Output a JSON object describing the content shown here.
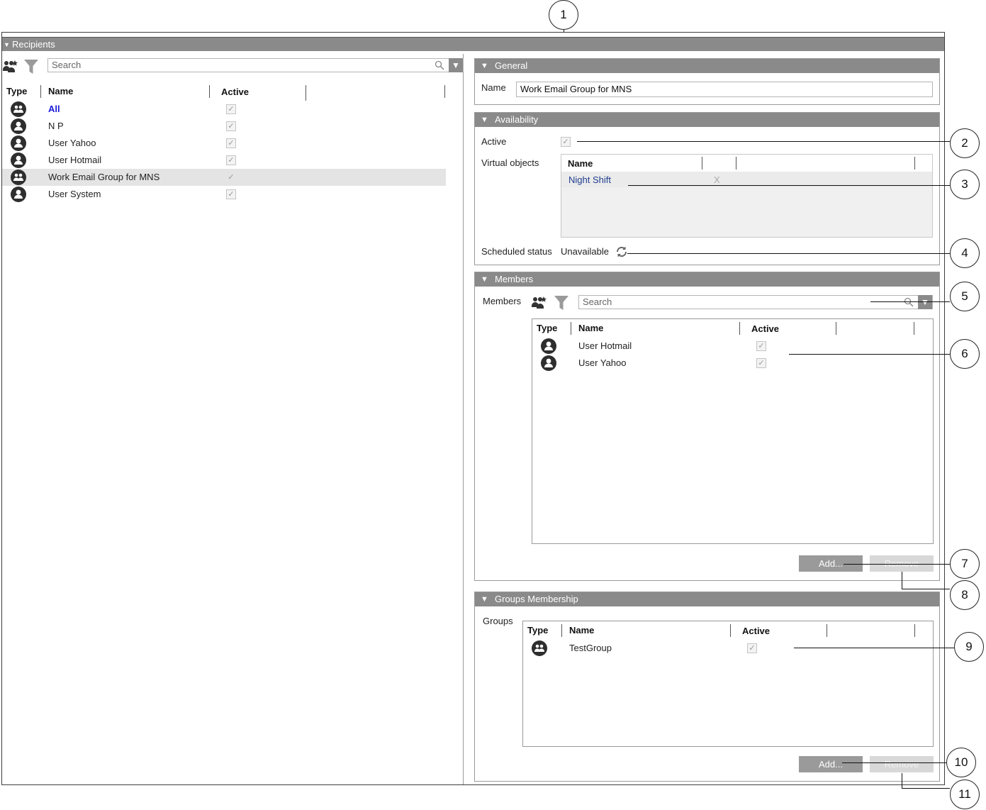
{
  "window": {
    "title": "Recipients"
  },
  "left": {
    "search_placeholder": "Search",
    "columns": {
      "type": "Type",
      "name": "Name",
      "active": "Active"
    },
    "rows": [
      {
        "name": "All",
        "icon": "group-icon",
        "active": true,
        "highlight": "link"
      },
      {
        "name": "N P",
        "icon": "user-icon",
        "active": true
      },
      {
        "name": "User Yahoo",
        "icon": "user-icon",
        "active": true
      },
      {
        "name": "User Hotmail",
        "icon": "user-icon",
        "active": true
      },
      {
        "name": "Work Email Group for MNS",
        "icon": "group-icon",
        "active": true,
        "selected": true
      },
      {
        "name": "User System",
        "icon": "user-icon",
        "active": true
      }
    ]
  },
  "general": {
    "title": "General",
    "name_label": "Name",
    "name_value": "Work Email Group for MNS"
  },
  "availability": {
    "title": "Availability",
    "active_label": "Active",
    "virtual_objects_label": "Virtual objects",
    "vo_column_name": "Name",
    "vo_rows": [
      {
        "name": "Night Shift",
        "remove": "X"
      }
    ],
    "scheduled_status_label": "Scheduled status",
    "scheduled_status_value": "Unavailable"
  },
  "members": {
    "title": "Members",
    "label": "Members",
    "search_placeholder": "Search",
    "columns": {
      "type": "Type",
      "name": "Name",
      "active": "Active"
    },
    "rows": [
      {
        "name": "User Hotmail",
        "icon": "user-icon",
        "active": true
      },
      {
        "name": "User Yahoo",
        "icon": "user-icon",
        "active": true
      }
    ],
    "add_label": "Add...",
    "remove_label": "Remove"
  },
  "groups": {
    "title": "Groups Membership",
    "label": "Groups",
    "columns": {
      "type": "Type",
      "name": "Name",
      "active": "Active"
    },
    "rows": [
      {
        "name": "TestGroup",
        "icon": "group-icon",
        "active": true
      }
    ],
    "add_label": "Add...",
    "remove_label": "Remove"
  },
  "callouts": [
    "1",
    "2",
    "3",
    "4",
    "5",
    "6",
    "7",
    "8",
    "9",
    "10",
    "11"
  ],
  "colors": {
    "section_bar": "#8a8a8a",
    "link": "#1a1adb",
    "selected_row": "#e4e4e4"
  }
}
